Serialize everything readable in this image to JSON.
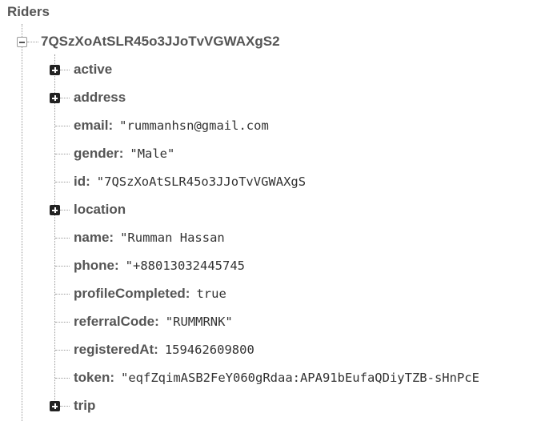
{
  "tree": {
    "root_label": "Riders",
    "rider": {
      "key": "7QSzXoAtSLR45o3JJoTvVGWAXgS2",
      "expanded": true
    },
    "children": [
      {
        "name": "active",
        "type": "branch",
        "value": ""
      },
      {
        "name": "address",
        "type": "branch",
        "value": ""
      },
      {
        "name": "email",
        "type": "leaf",
        "value": "\"rummanhsn@gmail.com"
      },
      {
        "name": "gender",
        "type": "leaf",
        "value": "\"Male\""
      },
      {
        "name": "id",
        "type": "leaf",
        "value": "\"7QSzXoAtSLR45o3JJoTvVGWAXgS"
      },
      {
        "name": "location",
        "type": "branch",
        "value": ""
      },
      {
        "name": "name",
        "type": "leaf",
        "value": "\"Rumman Hassan"
      },
      {
        "name": "phone",
        "type": "leaf",
        "value": "\"+88013032445745"
      },
      {
        "name": "profileCompleted",
        "type": "leaf",
        "value": "true"
      },
      {
        "name": "referralCode",
        "type": "leaf",
        "value": "\"RUMMRNK\""
      },
      {
        "name": "registeredAt",
        "type": "leaf",
        "value": "159462609800"
      },
      {
        "name": "token",
        "type": "leaf",
        "value": "\"eqfZqimASB2FeY060gRdaa:APA91bEufaQDiyTZB-sHnPcE"
      },
      {
        "name": "trip",
        "type": "branch",
        "value": ""
      }
    ],
    "colon": ":"
  }
}
